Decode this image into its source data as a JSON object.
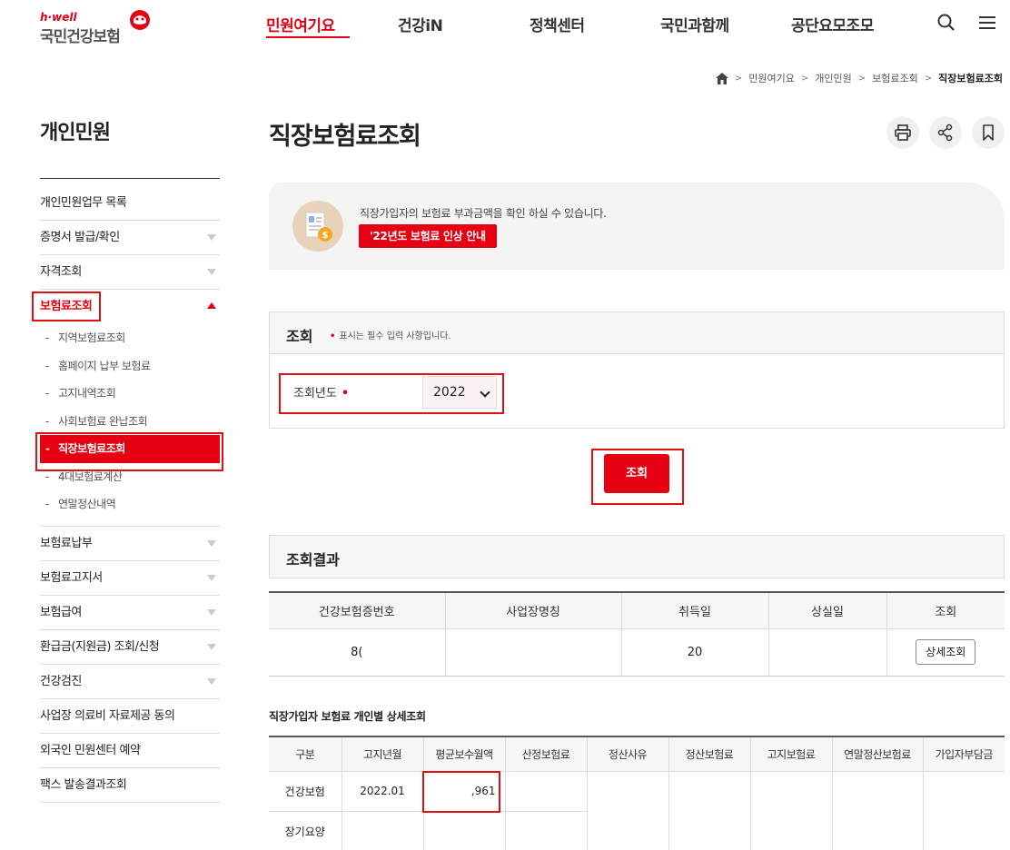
{
  "header": {
    "logo_top": "h·well",
    "logo_name": "국민건강보험",
    "nav": [
      "민원여기요",
      "건강iN",
      "정책센터",
      "국민과함께",
      "공단요모조모"
    ],
    "active_nav": "민원여기요"
  },
  "breadcrumb": [
    "민원여기요",
    "개인민원",
    "보험료조회",
    "직장보험료조회"
  ],
  "sidebar": {
    "title": "개인민원",
    "items": [
      {
        "label": "개인민원업무 목록",
        "arrow": false
      },
      {
        "label": "증명서 발급/확인",
        "arrow": true
      },
      {
        "label": "자격조회",
        "arrow": true
      },
      {
        "label": "보험료조회",
        "arrow": true,
        "open": true
      },
      {
        "label": "보험료납부",
        "arrow": true
      },
      {
        "label": "보험료고지서",
        "arrow": true
      },
      {
        "label": "보험급여",
        "arrow": true
      },
      {
        "label": "환급금(지원금) 조회/신청",
        "arrow": true
      },
      {
        "label": "건강검진",
        "arrow": true
      },
      {
        "label": "사업장 의료비 자료제공 동의",
        "arrow": false
      },
      {
        "label": "외국인 민원센터 예약",
        "arrow": false
      },
      {
        "label": "팩스 발송결과조회",
        "arrow": false
      }
    ],
    "sub_items": [
      "지역보험료조회",
      "홈페이지 납부 보험료",
      "고지내역조회",
      "사회보험료 완납조회",
      "직장보험료조회",
      "4대보험료계산",
      "연말정산내역"
    ],
    "active_sub": "직장보험료조회"
  },
  "main": {
    "title": "직장보험료조회",
    "info_text": "직장가입자의 보험료 부과금액을 확인 하실 수 있습니다.",
    "info_button": "'22년도 보험료 인상 안내",
    "query": {
      "heading": "조회",
      "required_note": "표시는 필수 입력 사항입니다.",
      "year_label": "조회년도",
      "year_value": "2022",
      "search_button": "조회"
    },
    "result": {
      "heading": "조회결과",
      "columns": [
        "건강보험증번호",
        "사업장명칭",
        "취득일",
        "상실일",
        "조회"
      ],
      "row": {
        "card_no": "8(",
        "company": "",
        "acquired": "20",
        "lost": "",
        "action": "상세조회"
      }
    },
    "detail": {
      "title": "직장가입자 보험료 개인별 상세조회",
      "columns": [
        "구분",
        "고지년월",
        "평균보수월액",
        "산정보험료",
        "정산사유",
        "정산보험료",
        "고지보험료",
        "연말정산보험료",
        "가입자부담금"
      ],
      "rows": [
        {
          "type": "건강보험",
          "month": "2022.01",
          "avg_pay": ",961"
        },
        {
          "type": "장기요양",
          "month": "",
          "avg_pay": ""
        }
      ]
    }
  },
  "colors": {
    "accent": "#e60012",
    "highlight_box": "#e01010"
  }
}
